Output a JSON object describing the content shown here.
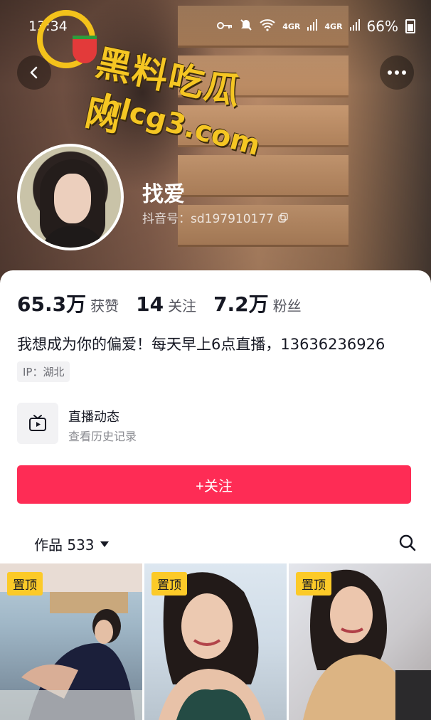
{
  "status_bar": {
    "time": "13:34",
    "signal_1": "4GR",
    "signal_2": "4GR",
    "battery": "66%"
  },
  "watermark": {
    "title": "黑料吃瓜网",
    "url": "hlcg3.com"
  },
  "profile": {
    "nickname": "找爱",
    "douyin_id": "抖音号：sd197910177"
  },
  "stats": [
    {
      "value": "65.3万",
      "label": "获赞"
    },
    {
      "value": "14",
      "label": "关注"
    },
    {
      "value": "7.2万",
      "label": "粉丝"
    }
  ],
  "bio": "我想成为你的偏爱！每天早上6点直播，13636236926",
  "ip_tag": "IP：湖北",
  "live": {
    "title": "直播动态",
    "subtitle": "查看历史记录"
  },
  "follow_button": "+关注",
  "works": {
    "label": "作品 533"
  },
  "videos": [
    {
      "badge": "置顶"
    },
    {
      "badge": "置顶"
    },
    {
      "badge": "置顶"
    }
  ],
  "colors": {
    "accent": "#fe2c55",
    "pin_badge": "#fcca28",
    "watermark": "#f5c623"
  },
  "icons": [
    "back-arrow-icon",
    "more-dots-icon",
    "copy-icon",
    "tv-live-icon",
    "caret-down-icon",
    "search-icon",
    "wifi-icon",
    "mute-icon",
    "key-icon",
    "battery-icon"
  ]
}
